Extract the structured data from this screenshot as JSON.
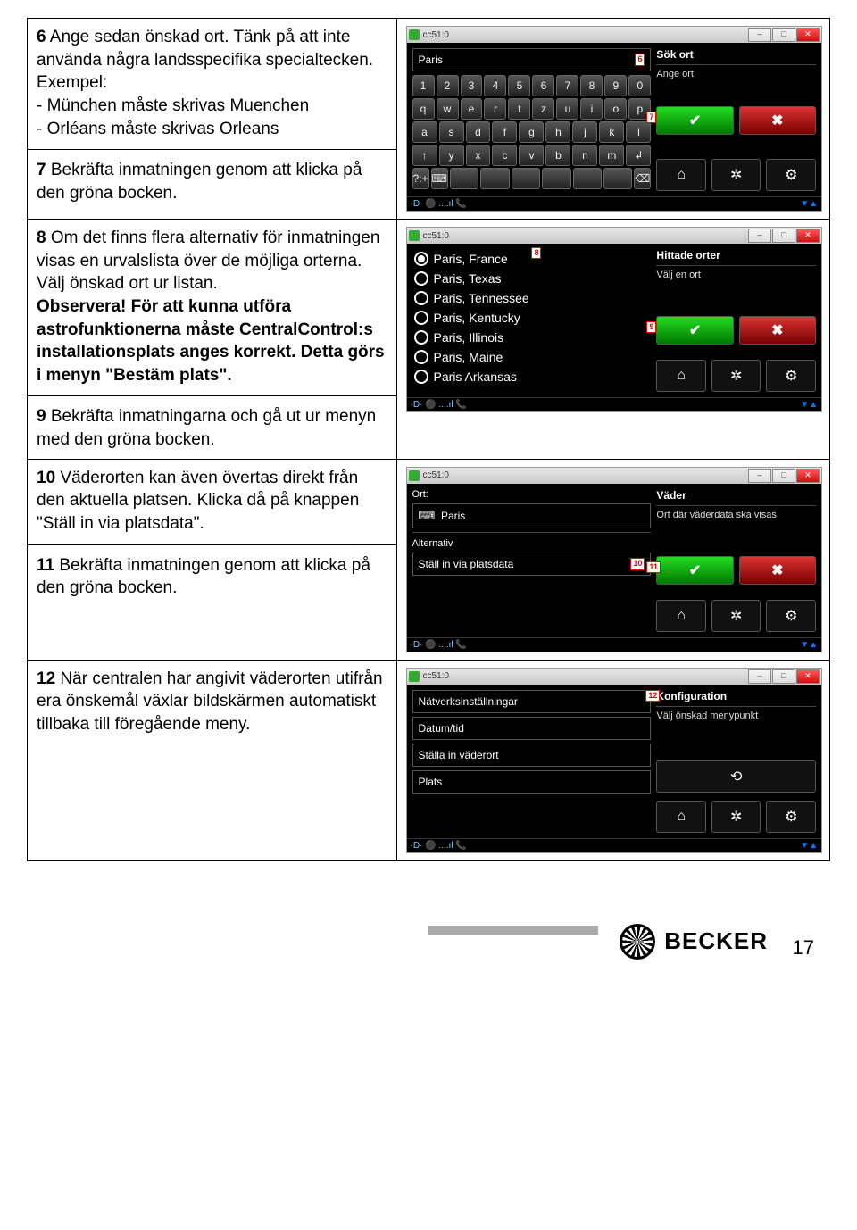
{
  "steps": {
    "s6": {
      "num": "6",
      "lead": " Ange sedan önskad ort. Tänk på att inte använda några landsspecifika specialtecken.",
      "ex_label": "Exempel:",
      "ex1": "- München måste skrivas Muenchen",
      "ex2": "- Orléans måste skrivas Orleans"
    },
    "s7": {
      "num": "7",
      "text": " Bekräfta inmatningen genom att klicka på den gröna bocken."
    },
    "s8": {
      "num": "8",
      "text": " Om det finns flera alternativ för inmatningen visas en urvalslista över de möjliga orterna.",
      "line2": "Välj önskad ort ur listan.",
      "obs_label": "Observera!",
      "obs_text": " För att kunna utföra astrofunktionerna måste CentralControl:s installationsplats anges korrekt. Detta görs i menyn \"Bestäm plats\"."
    },
    "s9": {
      "num": "9",
      "text": " Bekräfta inmatningarna och gå ut ur menyn med den gröna bocken."
    },
    "s10": {
      "num": "10",
      "text": " Väderorten kan även övertas direkt från den aktuella platsen. Klicka då på knappen \"Ställ in via platsdata\"."
    },
    "s11": {
      "num": "11",
      "text": " Bekräfta inmatningen genom att klicka på den gröna bocken."
    },
    "s12": {
      "num": "12",
      "text": " När centralen har angivit väderorten utifrån era önskemål växlar bildskärmen automatiskt tillbaka till föregående meny."
    }
  },
  "win": {
    "title": "cc51:0",
    "status_left": "·D·  ⚫ ....ıl 📞"
  },
  "screen1": {
    "input": "Paris",
    "marker_input": "6",
    "marker_ok": "7",
    "heading": "Sök ort",
    "sub": "Ange ort",
    "rows": [
      [
        "1",
        "2",
        "3",
        "4",
        "5",
        "6",
        "7",
        "8",
        "9",
        "0"
      ],
      [
        "q",
        "w",
        "e",
        "r",
        "t",
        "z",
        "u",
        "i",
        "o",
        "p"
      ],
      [
        "a",
        "s",
        "d",
        "f",
        "g",
        "h",
        "j",
        "k",
        "l"
      ],
      [
        "↑",
        "y",
        "x",
        "c",
        "v",
        "b",
        "n",
        "m",
        "↲"
      ],
      [
        "?:+",
        "⌨",
        "",
        "",
        "",
        "",
        "",
        "",
        "⌫"
      ]
    ]
  },
  "screen2": {
    "marker_top": "8",
    "marker_ok": "9",
    "heading": "Hittade orter",
    "sub": "Välj en ort",
    "items": [
      {
        "label": "Paris, France",
        "sel": true
      },
      {
        "label": "Paris, Texas",
        "sel": false
      },
      {
        "label": "Paris, Tennessee",
        "sel": false
      },
      {
        "label": "Paris, Kentucky",
        "sel": false
      },
      {
        "label": "Paris, Illinois",
        "sel": false
      },
      {
        "label": "Paris, Maine",
        "sel": false
      },
      {
        "label": "Paris  Arkansas",
        "sel": false
      }
    ]
  },
  "screen3": {
    "ort_label": "Ort:",
    "ort_value": "Paris",
    "alt_label": "Alternativ",
    "alt_btn": "Ställ in via platsdata",
    "marker_btn": "10",
    "marker_ok": "11",
    "heading": "Väder",
    "sub": "Ort där väderdata ska visas"
  },
  "screen4": {
    "items": [
      "Nätverksinställningar",
      "Datum/tid",
      "Ställa in väderort",
      "Plats"
    ],
    "marker": "12",
    "heading": "Konfiguration",
    "sub": "Välj önskad menypunkt"
  },
  "footer": {
    "brand": "BECKER",
    "page": "17"
  }
}
